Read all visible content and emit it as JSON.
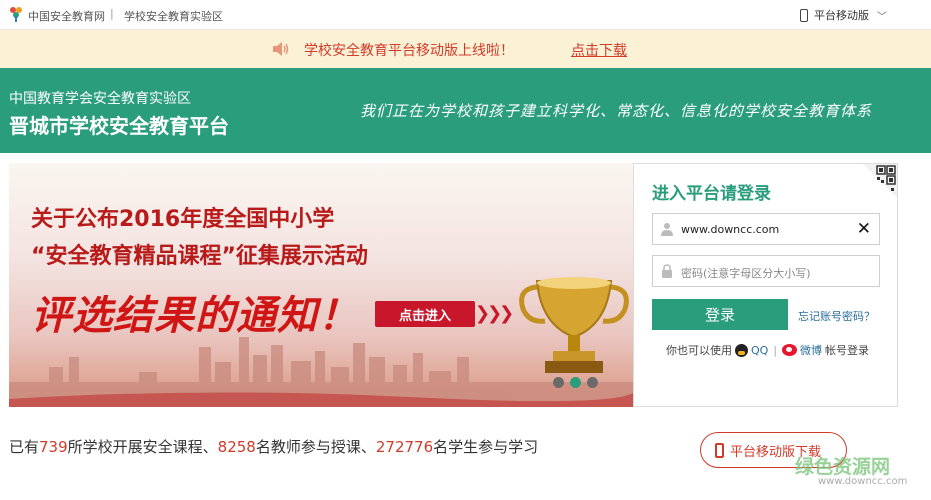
{
  "topbar": {
    "site_name": "中国安全教育网",
    "separator": "|",
    "zone_name": "学校安全教育实验区",
    "mobile_label": "平台移动版",
    "chevron": "﹀"
  },
  "notice": {
    "message": "学校安全教育平台移动版上线啦！",
    "link_label": "点击下载"
  },
  "header": {
    "org": "中国教育学会安全教育实验区",
    "platform": "晋城市学校安全教育平台",
    "slogan": "我们正在为学校和孩子建立科学化、常态化、信息化的学校安全教育体系"
  },
  "banner": {
    "line1": "关于公布2016年度全国中小学",
    "line2": "“安全教育精品课程”征集展示活动",
    "line3": "评选结果的通知！",
    "enter_label": "点击进入",
    "arrows": "❯❯❯",
    "slides": [
      {
        "active": false
      },
      {
        "active": true
      },
      {
        "active": false
      }
    ]
  },
  "login": {
    "heading": "进入平台请登录",
    "username_value": "www.downcc.com",
    "password_placeholder": "密码(注意字母区分大小写)",
    "clear": "✕",
    "login_label": "登录",
    "forgot_label": "忘记账号密码？",
    "alt_prefix": "你也可以使用",
    "qq_label": "QQ",
    "divider": "|",
    "weibo_label": "微博",
    "alt_suffix": "帐号登录"
  },
  "stats": {
    "p1": "已有",
    "schools": "739",
    "p2": "所学校开展安全课程、",
    "teachers": "8258",
    "p3": "名教师参与授课、",
    "students": "272776",
    "p4": "名学生参与学习"
  },
  "mobile_download": {
    "label": "平台移动版下载"
  },
  "watermark": {
    "name": "绿色资源网",
    "url": "www.downcc.com"
  },
  "colors": {
    "brand_green": "#2a9d7c",
    "accent_red": "#d23a2a",
    "notice_bg": "#fbf1d5"
  }
}
